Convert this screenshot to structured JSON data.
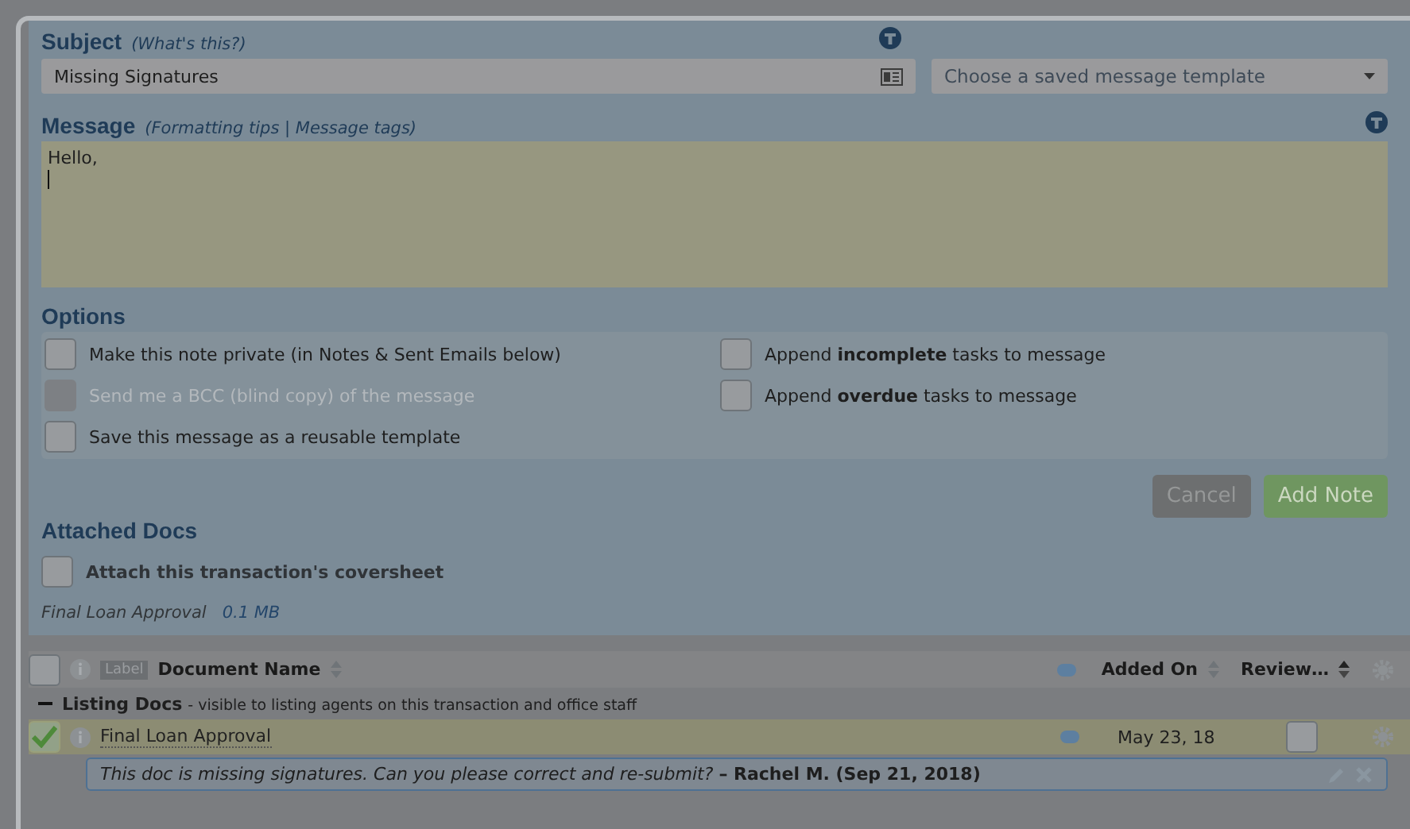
{
  "subject": {
    "label": "Subject",
    "help": "(What's this?)",
    "value": "Missing Signatures",
    "template_placeholder": "Choose a saved message template"
  },
  "message": {
    "label": "Message",
    "links": "(Formatting tips | Message tags)",
    "value": "Hello,"
  },
  "options": {
    "title": "Options",
    "items": [
      {
        "label": "Make this note private (in Notes & Sent Emails below)",
        "checked": false,
        "disabled": false
      },
      {
        "label": "Append **incomplete** tasks to message",
        "checked": false,
        "disabled": false
      },
      {
        "label": "Send me a BCC (blind copy) of the message",
        "checked": false,
        "disabled": true
      },
      {
        "label": "Append **overdue** tasks to message",
        "checked": false,
        "disabled": false
      },
      {
        "label": "Save this message as a reusable template",
        "checked": false,
        "disabled": false
      }
    ]
  },
  "buttons": [
    {
      "label": "Cancel",
      "kind": "secondary"
    },
    {
      "label": "Add Note",
      "kind": "primary"
    }
  ],
  "attached": {
    "title": "Attached Docs",
    "coversheet": {
      "label": "Attach this transaction's coversheet",
      "checked": false
    },
    "file": "Final Loan Approval",
    "size": "0.1 MB"
  },
  "table": {
    "select_all_checked": false,
    "label_tag": "Label",
    "columns": [
      "Document Name",
      "Added On",
      "Review…"
    ],
    "group": {
      "name": "Listing Docs",
      "note": "- visible to listing agents on this transaction and office staff"
    },
    "rows": [
      {
        "name": "Final Loan Approval",
        "added": "May 23, 18",
        "checked": true,
        "reviewed": false,
        "comment": {
          "text": "This doc is missing signatures. Can you please correct and re-submit?",
          "author": "– Rachel M. (Sep 21, 2018)"
        }
      }
    ]
  }
}
